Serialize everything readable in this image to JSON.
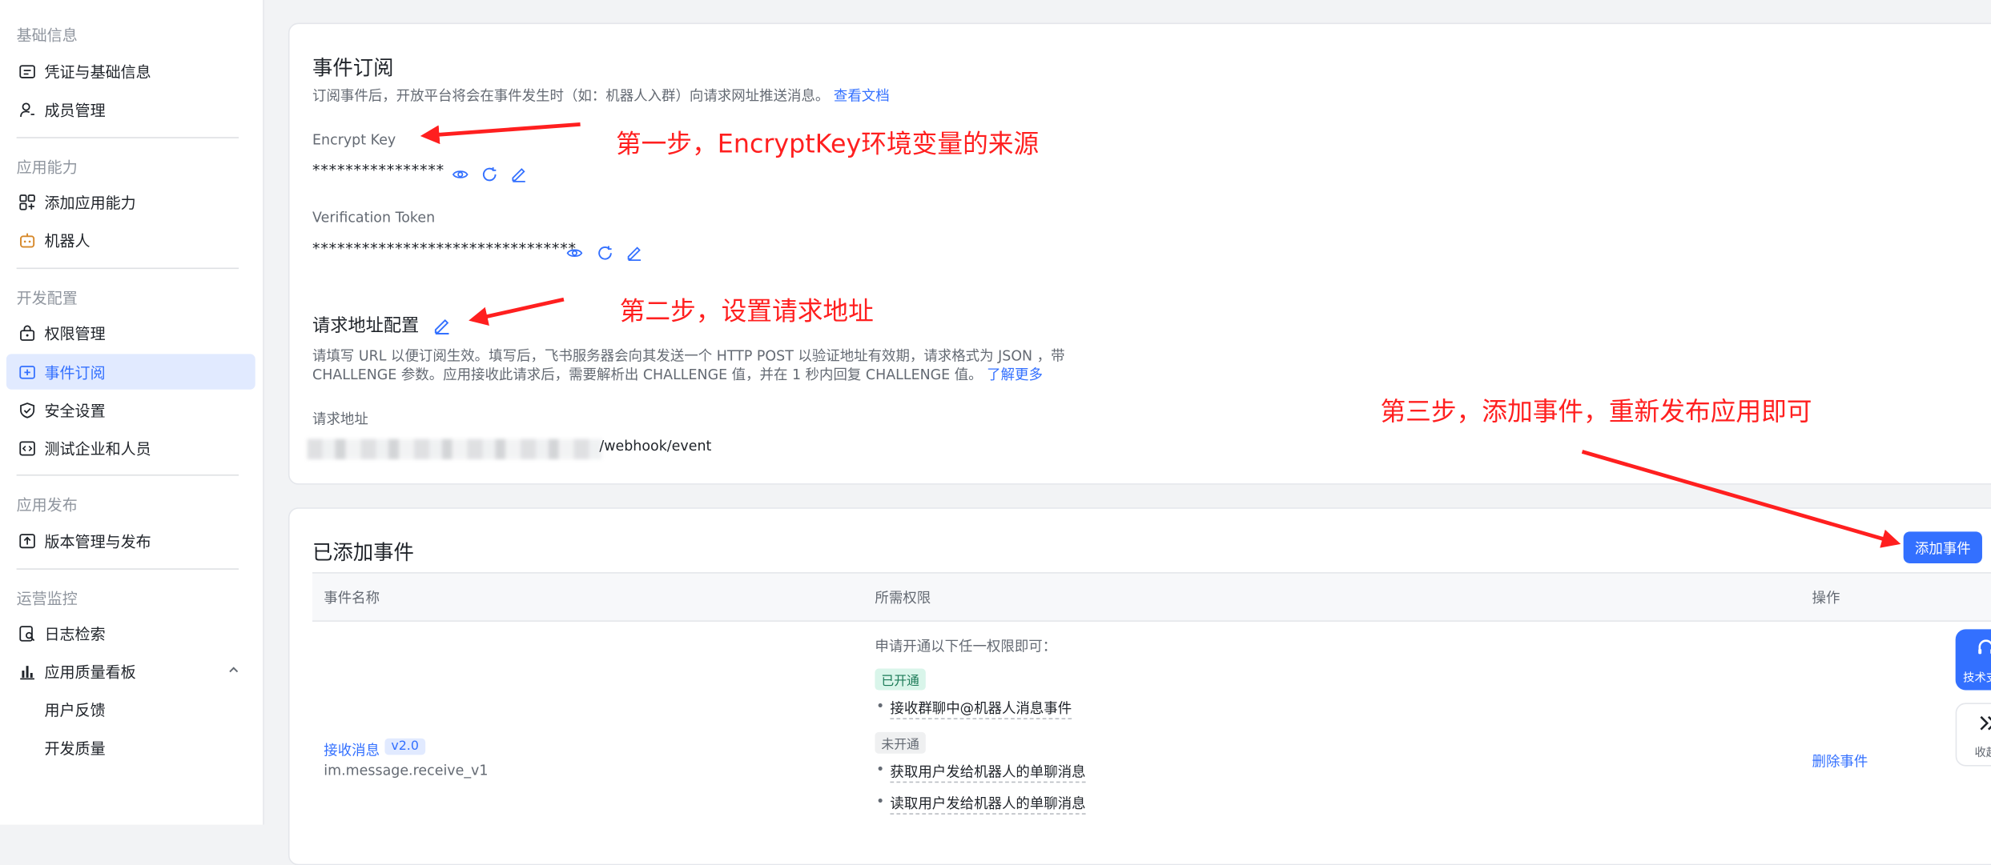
{
  "sidebar": {
    "sections": [
      {
        "title": "基础信息",
        "items": [
          {
            "label": "凭证与基础信息",
            "icon": "credential-icon"
          },
          {
            "label": "成员管理",
            "icon": "member-icon"
          }
        ]
      },
      {
        "title": "应用能力",
        "items": [
          {
            "label": "添加应用能力",
            "icon": "add-capability-icon"
          },
          {
            "label": "机器人",
            "icon": "robot-icon"
          }
        ]
      },
      {
        "title": "开发配置",
        "items": [
          {
            "label": "权限管理",
            "icon": "lock-icon"
          },
          {
            "label": "事件订阅",
            "icon": "event-icon"
          },
          {
            "label": "安全设置",
            "icon": "shield-icon"
          },
          {
            "label": "测试企业和人员",
            "icon": "code-icon"
          }
        ]
      },
      {
        "title": "应用发布",
        "items": [
          {
            "label": "版本管理与发布",
            "icon": "upload-icon"
          }
        ]
      },
      {
        "title": "运营监控",
        "items": [
          {
            "label": "日志检索",
            "icon": "log-search-icon"
          },
          {
            "label": "应用质量看板",
            "icon": "bar-chart-icon"
          },
          {
            "label": "用户反馈"
          },
          {
            "label": "开发质量"
          }
        ]
      }
    ],
    "active_item": "事件订阅"
  },
  "event_subscription": {
    "title": "事件订阅",
    "description": "订阅事件后，开放平台将会在事件发生时（如：机器人入群）向请求网址推送消息。",
    "doc_link": "查看文档",
    "encrypt_key": {
      "label": "Encrypt Key",
      "value": "****************"
    },
    "verification_token": {
      "label": "Verification Token",
      "value": "********************************"
    },
    "request_config": {
      "title": "请求地址配置",
      "desc_line1": "请填写 URL 以便订阅生效。填写后，飞书服务器会向其发送一个 HTTP POST 以验证地址有效期，请求格式为 JSON ，带",
      "desc_line2": "CHALLENGE 参数。应用接收此请求后，需要解析出 CHALLENGE 值，并在 1 秒内回复 CHALLENGE 值。",
      "learn_more": "了解更多",
      "url_label": "请求地址",
      "url_suffix": "/webhook/event"
    }
  },
  "added_events": {
    "title": "已添加事件",
    "add_button": "添加事件",
    "columns": [
      "事件名称",
      "所需权限",
      "操作"
    ],
    "rows": [
      {
        "event_name": "接收消息",
        "version": "v2.0",
        "event_key": "im.message.receive_v1",
        "permission_intro": "申请开通以下任一权限即可：",
        "enabled_tag": "已开通",
        "enabled_permissions": [
          "接收群聊中@机器人消息事件"
        ],
        "disabled_tag": "未开通",
        "disabled_permissions": [
          "获取用户发给机器人的单聊消息",
          "读取用户发给机器人的单聊消息"
        ],
        "action": "删除事件"
      }
    ]
  },
  "annotations": {
    "step1": "第一步，EncryptKey环境变量的来源",
    "step2": "第二步，设置请求地址",
    "step3": "第三步，添加事件，重新发布应用即可"
  },
  "floating": {
    "support_label": "技术支",
    "collapse_label": "收起"
  },
  "colors": {
    "accent": "#3370ff",
    "annotation": "#ff1f1f"
  }
}
